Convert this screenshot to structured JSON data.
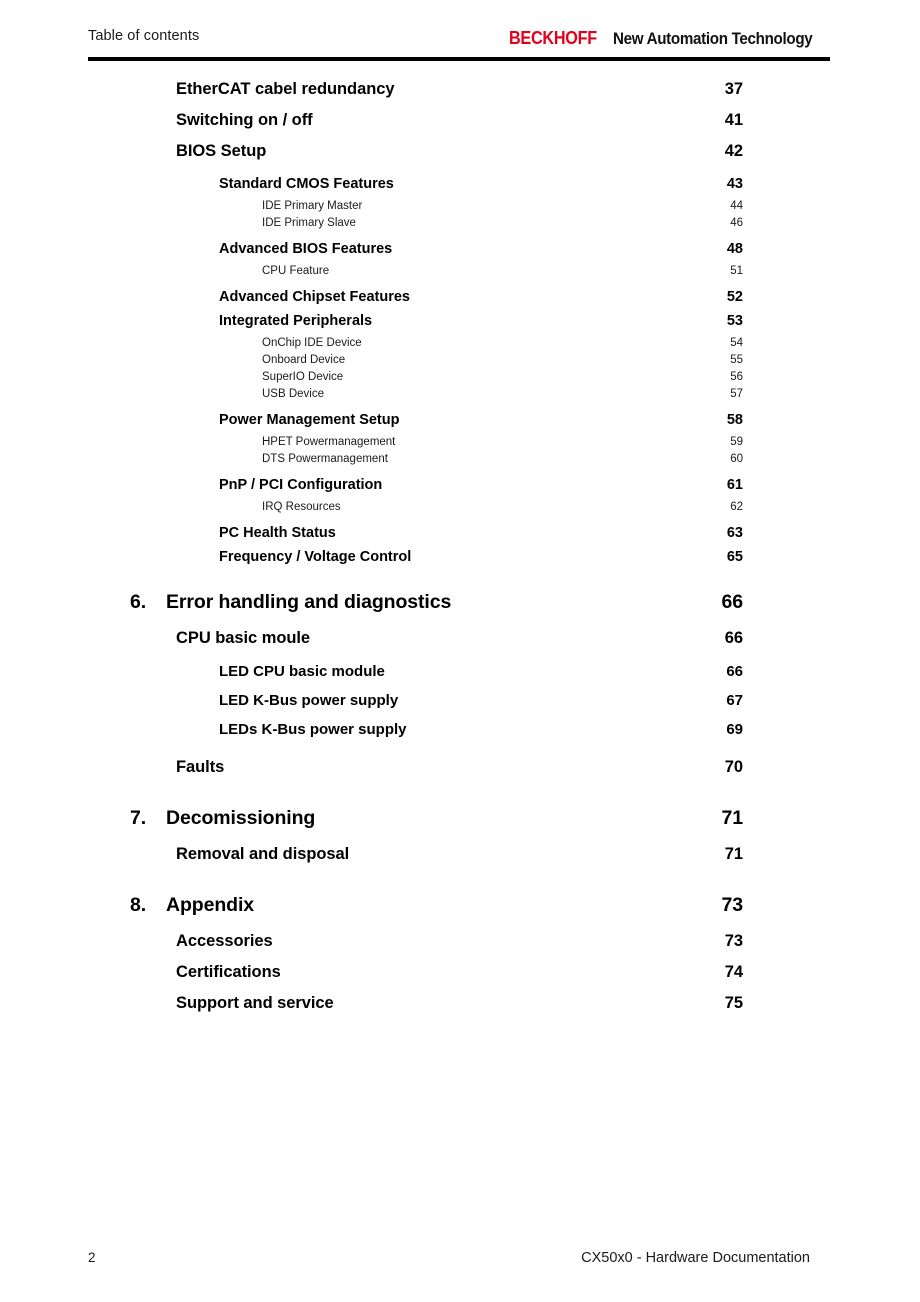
{
  "header": {
    "title": "Table of contents",
    "brand_mark": "BECKHOFF",
    "brand_tagline": "New Automation Technology",
    "brand_color": "#e2001a",
    "rule_color": "#000000"
  },
  "toc": {
    "entries": [
      {
        "level": 1,
        "number": "",
        "label": "EtherCAT cabel redundancy",
        "page": "37"
      },
      {
        "level": 1,
        "number": "",
        "label": "Switching on / off",
        "page": "41"
      },
      {
        "level": 1,
        "number": "",
        "label": "BIOS Setup",
        "page": "42"
      },
      {
        "level": 2,
        "number": "",
        "label": "Standard CMOS Features",
        "page": "43"
      },
      {
        "level": 3,
        "number": "",
        "label": "IDE Primary Master",
        "page": "44"
      },
      {
        "level": 3,
        "number": "",
        "label": "IDE Primary Slave",
        "page": "46"
      },
      {
        "level": 2,
        "number": "",
        "label": "Advanced BIOS Features",
        "page": "48"
      },
      {
        "level": 3,
        "number": "",
        "label": "CPU Feature",
        "page": "51"
      },
      {
        "level": 2,
        "number": "",
        "label": "Advanced Chipset Features",
        "page": "52"
      },
      {
        "level": 2,
        "number": "",
        "label": "Integrated Peripherals",
        "page": "53"
      },
      {
        "level": 3,
        "number": "",
        "label": "OnChip IDE Device",
        "page": "54"
      },
      {
        "level": 3,
        "number": "",
        "label": "Onboard Device",
        "page": "55"
      },
      {
        "level": 3,
        "number": "",
        "label": "SuperIO Device",
        "page": "56"
      },
      {
        "level": 3,
        "number": "",
        "label": "USB Device",
        "page": "57"
      },
      {
        "level": 2,
        "number": "",
        "label": "Power Management Setup",
        "page": "58"
      },
      {
        "level": 3,
        "number": "",
        "label": "HPET Powermanagement",
        "page": "59"
      },
      {
        "level": 3,
        "number": "",
        "label": "DTS Powermanagement",
        "page": "60"
      },
      {
        "level": 2,
        "number": "",
        "label": "PnP / PCI Configuration",
        "page": "61"
      },
      {
        "level": 3,
        "number": "",
        "label": "IRQ Resources",
        "page": "62"
      },
      {
        "level": 2,
        "number": "",
        "label": "PC Health Status",
        "page": "63"
      },
      {
        "level": 2,
        "number": "",
        "label": "Frequency / Voltage Control",
        "page": "65"
      },
      {
        "level": 0,
        "number": "6.",
        "label": "Error handling and diagnostics",
        "page": "66"
      },
      {
        "level": 1,
        "number": "",
        "label": "CPU basic moule",
        "page": "66"
      },
      {
        "level": 2,
        "number": "",
        "label": "LED CPU basic module",
        "page": "66"
      },
      {
        "level": 2,
        "number": "",
        "label": "LED K-Bus power supply",
        "page": "67"
      },
      {
        "level": 2,
        "number": "",
        "label": "LEDs K-Bus power supply",
        "page": "69"
      },
      {
        "level": 1,
        "number": "",
        "label": "Faults",
        "page": "70"
      },
      {
        "level": 0,
        "number": "7.",
        "label": "Decomissioning",
        "page": "71"
      },
      {
        "level": 1,
        "number": "",
        "label": "Removal and disposal",
        "page": "71"
      },
      {
        "level": 0,
        "number": "8.",
        "label": "Appendix",
        "page": "73"
      },
      {
        "level": 1,
        "number": "",
        "label": "Accessories",
        "page": "73"
      },
      {
        "level": 1,
        "number": "",
        "label": "Certifications",
        "page": "74"
      },
      {
        "level": 1,
        "number": "",
        "label": "Support and service",
        "page": "75"
      }
    ]
  },
  "footer": {
    "page_number": "2",
    "document_title": "CX50x0 - Hardware Documentation"
  }
}
